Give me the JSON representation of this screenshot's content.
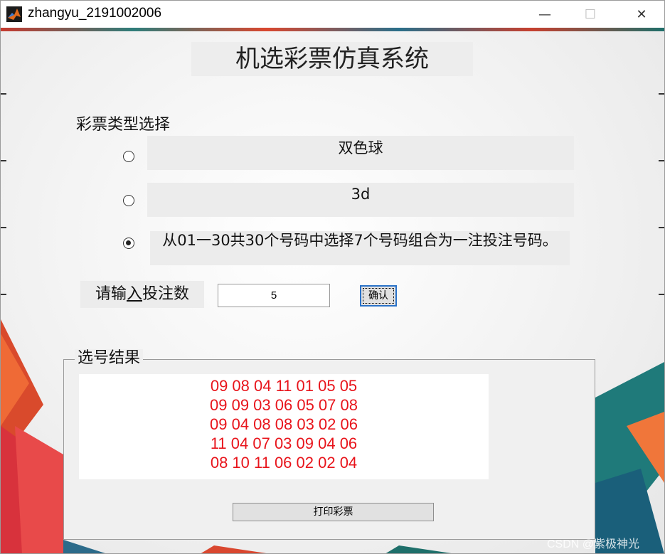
{
  "window": {
    "title": "zhangyu_2191002006",
    "minimize": "—",
    "maximize": "☐",
    "close": "✕"
  },
  "main": {
    "title": "机选彩票仿真系统",
    "lottery_type_label": "彩票类型选择",
    "options": [
      {
        "label": "双色球",
        "selected": false
      },
      {
        "label": "3d",
        "selected": false
      },
      {
        "label": "从01一30共30个号码中选择7个号码组合为一注投注号码。",
        "selected": true
      }
    ],
    "bet_label_pre": "请输",
    "bet_label_acc": "入",
    "bet_label_post": "投注数",
    "bet_value": "5",
    "confirm_label": "确认"
  },
  "results": {
    "legend": "选号结果",
    "lines": [
      "09 08 04 11 01 05 05",
      "09 09 03 06 05 07 08",
      "09 04 08 08 03 02 06",
      "11 04 07 03 09 04 06",
      "08 10 11 06 02 02 04"
    ],
    "result_color": "#e8141b",
    "print_label": "打印彩票"
  },
  "watermark": "CSDN @紫极神光"
}
